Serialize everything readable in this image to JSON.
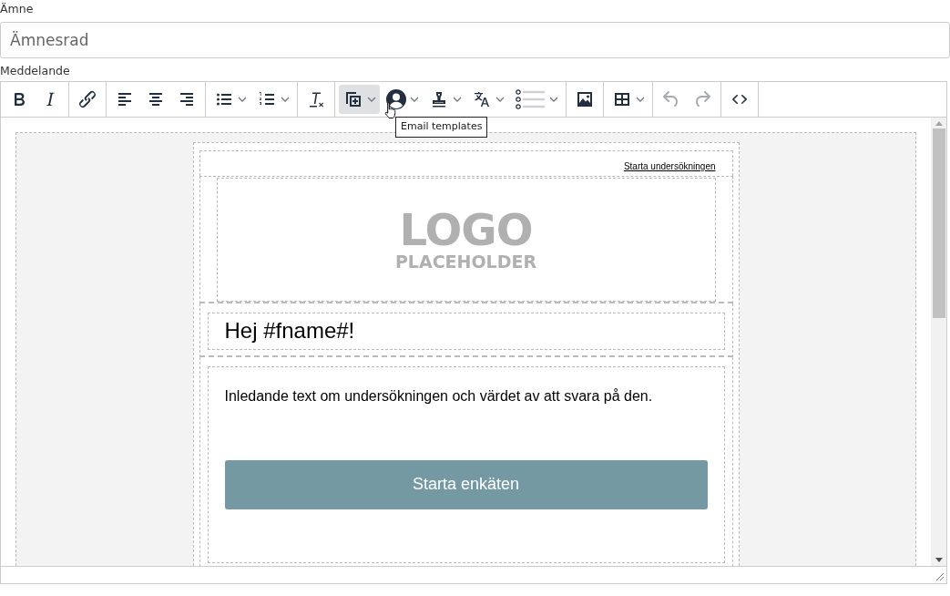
{
  "subject": {
    "label": "Ämne",
    "placeholder": "Ämnesrad"
  },
  "message": {
    "label": "Meddelande"
  },
  "toolbar": [
    [
      {
        "menu": false,
        "highlighted": false,
        "disabled": false
      },
      {
        "menu": false,
        "highlighted": false,
        "disabled": false
      }
    ],
    [
      {
        "menu": false,
        "highlighted": false,
        "disabled": false
      }
    ],
    [
      {
        "menu": false,
        "highlighted": false,
        "disabled": false
      },
      {
        "menu": false,
        "highlighted": false,
        "disabled": false
      },
      {
        "menu": false,
        "highlighted": false,
        "disabled": false
      }
    ],
    [
      {
        "menu": true,
        "highlighted": false,
        "disabled": false
      },
      {
        "menu": true,
        "highlighted": false,
        "disabled": false
      }
    ],
    [
      {
        "menu": false,
        "highlighted": false,
        "disabled": false
      }
    ],
    [
      {
        "menu": true,
        "highlighted": true,
        "disabled": false
      },
      {
        "menu": true,
        "highlighted": false,
        "disabled": false
      },
      {
        "menu": true,
        "highlighted": false,
        "disabled": false
      },
      {
        "menu": true,
        "highlighted": false,
        "disabled": false
      },
      {
        "menu": true,
        "highlighted": false,
        "disabled": false
      }
    ],
    [
      {
        "menu": false,
        "highlighted": false,
        "disabled": false
      }
    ],
    [
      {
        "menu": true,
        "highlighted": false,
        "disabled": false
      }
    ],
    [
      {
        "menu": false,
        "highlighted": false,
        "disabled": true
      },
      {
        "menu": false,
        "highlighted": false,
        "disabled": true
      }
    ],
    [
      {
        "menu": false,
        "highlighted": false,
        "disabled": false
      }
    ]
  ],
  "tooltip": "Email templates",
  "email": {
    "top_link": "Starta undersökningen",
    "logo": [
      "LOGO",
      "PLACEHOLDER"
    ],
    "greeting": "Hej #fname#!",
    "intro": "Inledande text om undersökningen och värdet av att svara på den.",
    "button": "Starta enkäten"
  }
}
